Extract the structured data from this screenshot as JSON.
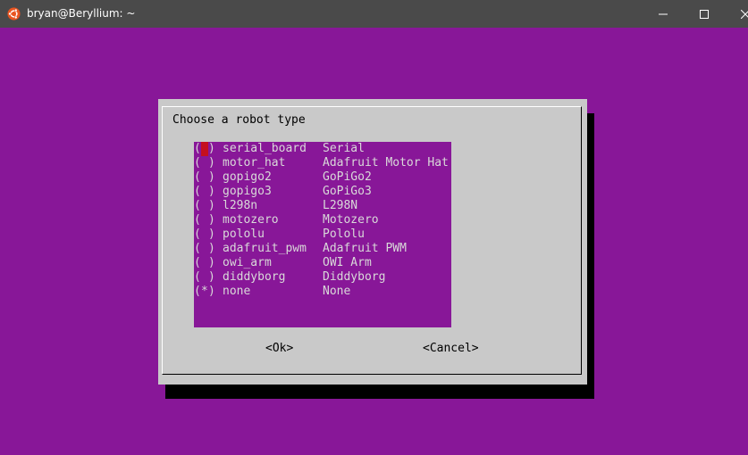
{
  "window": {
    "title": "bryan@Beryllium: ~",
    "app_icon": "ubuntu-icon",
    "controls": [
      "minimize-icon",
      "maximize-icon",
      "close-icon"
    ]
  },
  "colors": {
    "terminal_background": "#881798",
    "titlebar": "#4a4a4a",
    "dialog_background": "#c9c9c9",
    "list_text": "#d9d9d9",
    "cursor": "#c50f1f"
  },
  "dialog": {
    "prompt": "Choose a robot type",
    "items": [
      {
        "open": "(",
        "mark": " ",
        "close": ")",
        "key": "serial_board",
        "desc": "Serial"
      },
      {
        "open": "(",
        "mark": " ",
        "close": ")",
        "key": "motor_hat",
        "desc": "Adafruit Motor Hat"
      },
      {
        "open": "(",
        "mark": " ",
        "close": ")",
        "key": "gopigo2",
        "desc": "GoPiGo2"
      },
      {
        "open": "(",
        "mark": " ",
        "close": ")",
        "key": "gopigo3",
        "desc": "GoPiGo3"
      },
      {
        "open": "(",
        "mark": " ",
        "close": ")",
        "key": "l298n",
        "desc": "L298N"
      },
      {
        "open": "(",
        "mark": " ",
        "close": ")",
        "key": "motozero",
        "desc": "Motozero"
      },
      {
        "open": "(",
        "mark": " ",
        "close": ")",
        "key": "pololu",
        "desc": "Pololu"
      },
      {
        "open": "(",
        "mark": " ",
        "close": ")",
        "key": "adafruit_pwm",
        "desc": "Adafruit PWM"
      },
      {
        "open": "(",
        "mark": " ",
        "close": ")",
        "key": "owi_arm",
        "desc": "OWI Arm"
      },
      {
        "open": "(",
        "mark": " ",
        "close": ")",
        "key": "diddyborg",
        "desc": "Diddyborg"
      },
      {
        "open": "(",
        "mark": "*",
        "close": ")",
        "key": "none",
        "desc": "None"
      }
    ],
    "ok_label": "<Ok>",
    "cancel_label": "<Cancel>"
  }
}
